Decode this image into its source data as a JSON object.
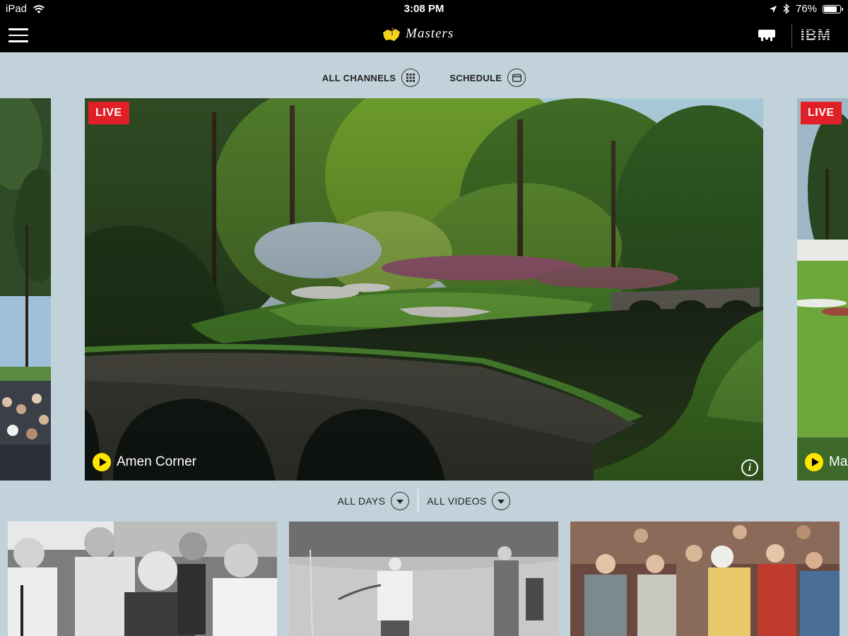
{
  "status_bar": {
    "device": "iPad",
    "time": "3:08 PM",
    "battery": "76%",
    "battery_level": 0.76
  },
  "header": {
    "app_title": "Masters",
    "sponsor": "IBM"
  },
  "channel_nav": {
    "all_channels": "ALL CHANNELS",
    "schedule": "SCHEDULE"
  },
  "carousel": {
    "live_label": "LIVE",
    "main": {
      "title": "Amen Corner"
    },
    "next": {
      "title": "Ma"
    }
  },
  "filters": {
    "days": "ALL DAYS",
    "videos": "ALL VIDEOS"
  },
  "colors": {
    "background": "#c2d2da",
    "live_red": "#e11f26",
    "play_yellow": "#ffe600",
    "header_black": "#000000"
  },
  "icons": [
    "menu-icon",
    "wifi-icon",
    "location-icon",
    "bluetooth-icon",
    "battery-icon",
    "cast-icon",
    "grid-icon",
    "calendar-icon",
    "play-icon",
    "info-icon",
    "chevron-down-icon"
  ]
}
